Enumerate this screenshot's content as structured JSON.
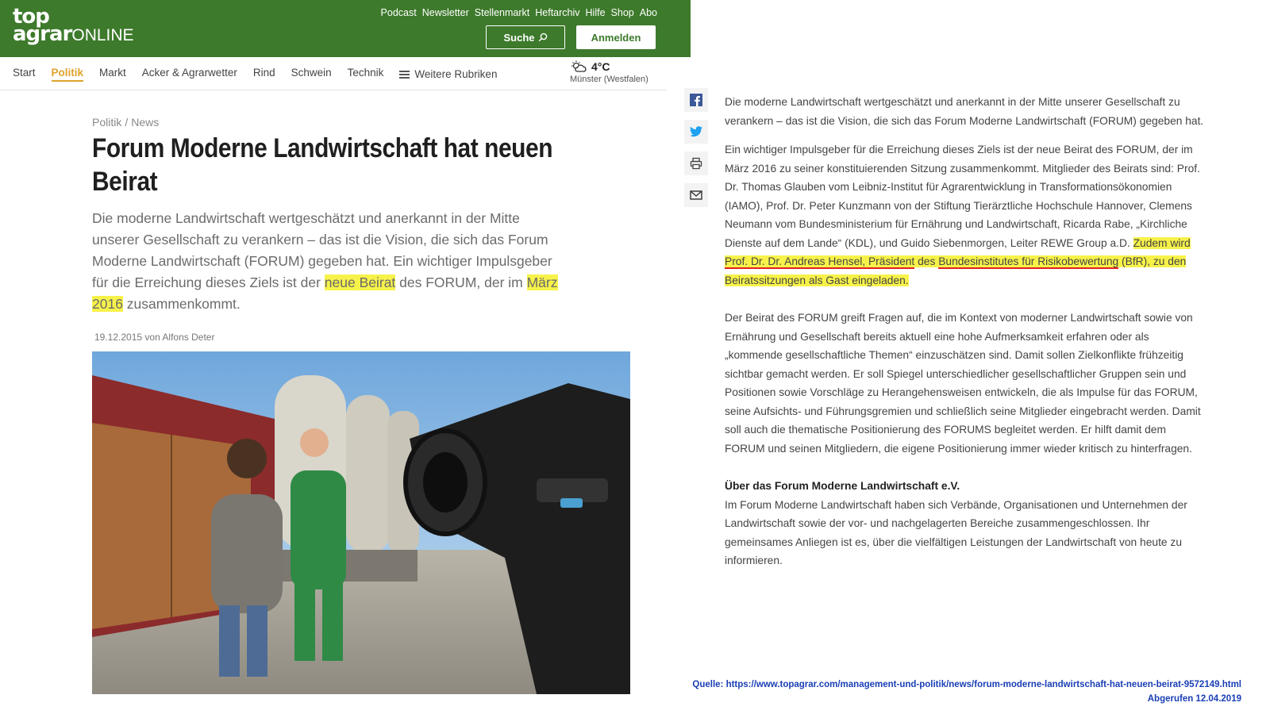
{
  "header": {
    "logo_top": "top",
    "logo_agrar": "agrar",
    "logo_online": "ONLINE",
    "top_links": [
      "Podcast",
      "Newsletter",
      "Stellenmarkt",
      "Heftarchiv",
      "Hilfe",
      "Shop",
      "Abo"
    ],
    "search_label": "Suche",
    "login_label": "Anmelden"
  },
  "nav": {
    "items": [
      "Start",
      "Politik",
      "Markt",
      "Acker & Agrarwetter",
      "Rind",
      "Schwein",
      "Technik"
    ],
    "active": "Politik",
    "more_label": "Weitere Rubriken"
  },
  "weather": {
    "temp": "4°C",
    "city": "Münster (Westfalen)"
  },
  "article": {
    "breadcrumb": [
      "Politik",
      "News"
    ],
    "title": "Forum Moderne Landwirtschaft hat neuen Beirat",
    "lead_1": "Die moderne Landwirtschaft wertgeschätzt und anerkannt in der Mitte unserer Gesellschaft zu verankern – das ist die Vision, die sich das Forum Moderne Landwirtschaft (FORUM) gegeben hat. Ein wichtiger Impulsgeber für die Erreichung dieses Ziels ist der ",
    "lead_hl_1": "neue Beirat",
    "lead_2": " des FORUM, der im ",
    "lead_hl_2": "März 2016",
    "lead_3": " zusammenkommt.",
    "meta": "19.12.2015 von Alfons Deter"
  },
  "body": {
    "p1": "Die moderne Landwirtschaft wertgeschätzt und anerkannt in der Mitte unserer Gesellschaft zu verankern – das ist die Vision, die sich das Forum Moderne Landwirtschaft (FORUM) gegeben hat.",
    "p2_a": "Ein wichtiger Impulsgeber für die Erreichung dieses Ziels ist der neue Beirat des FORUM, der im März 2016 zu seiner konstituierenden Sitzung zusammenkommt. Mitglieder des Beirats sind: Prof. Dr. Thomas Glauben vom Leibniz-Institut für Agrarentwicklung in Transformationsökonomien (IAMO), Prof. Dr. Peter Kunzmann von der Stiftung Tierärztliche Hochschule Hannover, Clemens Neumann vom Bundesministerium für Ernährung und Landwirtschaft, Ricarda Rabe, „Kirchliche Dienste auf dem Lande“ (KDL), und Guido Siebenmorgen, Leiter REWE Group a.D.",
    "p2_hl_a": "Zudem wird ",
    "p2_hl_b": "Prof. Dr. Dr. Andreas Hensel, Präsident",
    "p2_hl_c": " des ",
    "p2_hl_d": "Bundesinstitutes für Risikobewertung",
    "p2_hl_e": " (BfR), zu den Beiratssitzungen als Gast eingeladen.",
    "p3": "Der Beirat des FORUM greift Fragen auf, die im Kontext von moderner Landwirtschaft sowie von Ernährung und Gesellschaft bereits aktuell eine hohe Aufmerksamkeit erfahren oder als „kommende gesellschaftliche Themen“ einzuschätzen sind. Damit sollen Zielkonflikte frühzeitig sichtbar gemacht werden. Er soll Spiegel unterschiedlicher gesellschaftlicher Gruppen sein und Positionen sowie Vorschläge zu Herangehensweisen entwickeln, die als Impulse für das FORUM, seine Aufsichts- und Führungsgremien und schließlich seine Mitglieder eingebracht werden. Damit soll auch die thematische Positionierung des FORUMS begleitet werden. Er hilft damit dem FORUM und seinen Mitgliedern, die eigene Positionierung immer wieder kritisch zu hinterfragen.",
    "p4_heading": "Über das Forum Moderne Landwirtschaft e.V.",
    "p4": "Im Forum Moderne Landwirtschaft haben sich Verbände, Organisationen und Unternehmen der Landwirtschaft sowie der vor- und nachgelagerten Bereiche zusammengeschlossen. Ihr gemeinsames Anliegen ist es, über die vielfältigen Leistungen der Landwirtschaft von heute zu informieren."
  },
  "share_icons": [
    "facebook-icon",
    "twitter-icon",
    "print-icon",
    "mail-icon"
  ],
  "source": {
    "line1": "Quelle: https://www.topagrar.com/management-und-politik/news/forum-moderne-landwirtschaft-hat-neuen-beirat-9572149.html",
    "line2": "Abgerufen 12.04.2019"
  },
  "colors": {
    "brand_green": "#3d7a2b",
    "active_nav": "#e0a22b",
    "highlight": "#f7f24a",
    "underline": "#e02020",
    "source_blue": "#1a3fb5"
  }
}
